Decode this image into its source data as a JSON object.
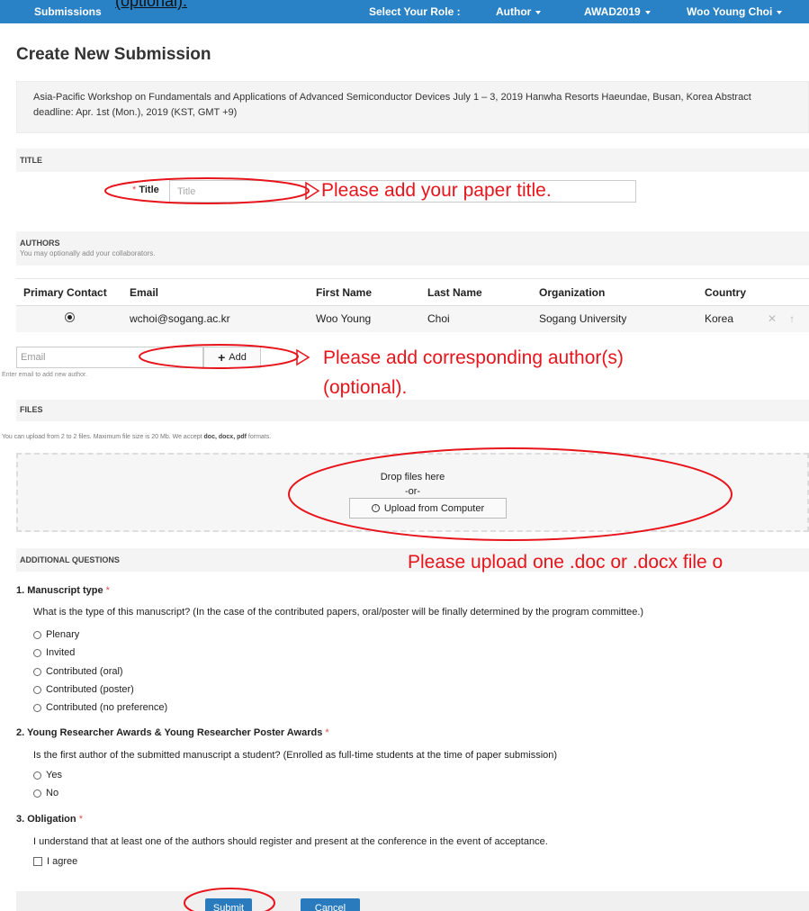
{
  "overflow_note": "(optional).",
  "nav": {
    "submissions": "Submissions",
    "select_role_label": "Select Your Role :",
    "role": "Author",
    "conference": "AWAD2019",
    "user": "Woo Young Choi"
  },
  "page_title": "Create New Submission",
  "description": "Asia-Pacific Workshop on Fundamentals and Applications of Advanced Semiconductor Devices July 1 – 3, 2019 Hanwha Resorts Haeundae, Busan, Korea Abstract deadline: Apr. 1st (Mon.), 2019 (KST, GMT +9)",
  "title_section": {
    "heading": "TITLE",
    "required_mark": "*",
    "label": "Title",
    "placeholder": "Title"
  },
  "authors_section": {
    "heading": "AUTHORS",
    "subheading": "You may optionally add your collaborators.",
    "columns": [
      "Primary Contact",
      "Email",
      "First Name",
      "Last Name",
      "Organization",
      "Country"
    ],
    "rows": [
      {
        "email": "wchoi@sogang.ac.kr",
        "first_name": "Woo Young",
        "last_name": "Choi",
        "organization": "Sogang University",
        "country": "Korea"
      }
    ],
    "email_placeholder": "Email",
    "add_button": "Add",
    "hint": "Enter email to add new author."
  },
  "files_section": {
    "heading": "FILES",
    "hint_prefix": "You can upload from 2 to 2 files. Maximum file size is 20 Mb. We accept",
    "hint_formats": "doc, docx, pdf",
    "hint_suffix": "formats.",
    "drop_text": "Drop files here",
    "or_text": "-or-",
    "upload_button": "Upload from Computer"
  },
  "additional_section": {
    "heading": "ADDITIONAL QUESTIONS",
    "required_mark": "*",
    "q1": {
      "title": "1. Manuscript type",
      "text": "What is the type of this manuscript? (In the case of the contributed papers, oral/poster will be finally determined by the program committee.)",
      "options": [
        "Plenary",
        "Invited",
        "Contributed (oral)",
        "Contributed (poster)",
        "Contributed (no preference)"
      ]
    },
    "q2": {
      "title": "2. Young Researcher Awards & Young Researcher Poster Awards",
      "text": "Is the first author of the submitted manuscript a student? (Enrolled as full-time students at the time of paper submission)",
      "options": [
        "Yes",
        "No"
      ]
    },
    "q3": {
      "title": "3. Obligation",
      "text": "I understand that at least one of the authors should register and present at the conference in the event of acceptance.",
      "checkbox": "I agree"
    }
  },
  "footer": {
    "submit": "Submit",
    "cancel": "Cancel"
  },
  "annotations": {
    "title_note": "Please add your paper title.",
    "authors_note_line1": "Please  add  corresponding  author(s)",
    "authors_note_line2": "(optional).",
    "files_note": "Please upload one .doc or .docx file o"
  },
  "colors": {
    "nav_bar": "#2a82c6",
    "annotation": "#e8141c",
    "primary_button": "#2a7bbd"
  }
}
